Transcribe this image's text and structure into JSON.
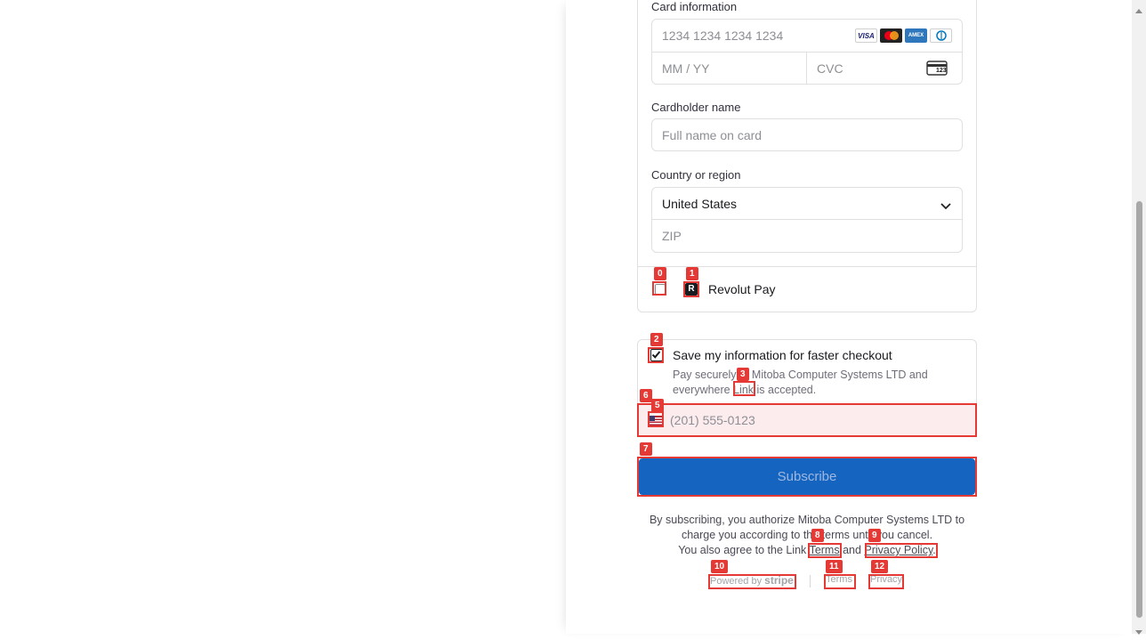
{
  "card": {
    "section_label": "Card information",
    "number_placeholder": "1234 1234 1234 1234",
    "expiry_placeholder": "MM / YY",
    "cvc_placeholder": "CVC",
    "brands": [
      "VISA",
      "AMEX"
    ],
    "cvc_icon_text": "123"
  },
  "cardholder": {
    "label": "Cardholder name",
    "placeholder": "Full name on card"
  },
  "country": {
    "label": "Country or region",
    "selected": "United States",
    "zip_placeholder": "ZIP"
  },
  "revolut": {
    "label": "Revolut Pay",
    "logo_letter": "R"
  },
  "save_info": {
    "title": "Save my information for faster checkout",
    "desc_before": "Pay securely at Mitoba Computer Systems LTD and everywhere ",
    "link_text": "Link",
    "desc_after": " is accepted.",
    "phone_placeholder": "(201) 555-0123"
  },
  "subscribe": {
    "label": "Subscribe"
  },
  "legal": {
    "line1": "By subscribing, you authorize Mitoba Computer Systems LTD to charge you according to the terms until you cancel.",
    "line2_before": "You also agree to the Link ",
    "terms": "Terms",
    "and": " and ",
    "privacy_policy": "Privacy Policy",
    "period": "."
  },
  "footer": {
    "powered_by": "Powered by",
    "stripe": "stripe",
    "terms": "Terms",
    "privacy": "Privacy"
  },
  "overlay_tags": [
    "0",
    "1",
    "2",
    "3",
    "5",
    "6",
    "7",
    "8",
    "9",
    "10",
    "11",
    "12"
  ],
  "colors": {
    "subscribe_bg": "#1565c0",
    "subscribe_text": "#9fb7e0",
    "error_bg": "#fdecee",
    "overlay": "#e53935"
  }
}
